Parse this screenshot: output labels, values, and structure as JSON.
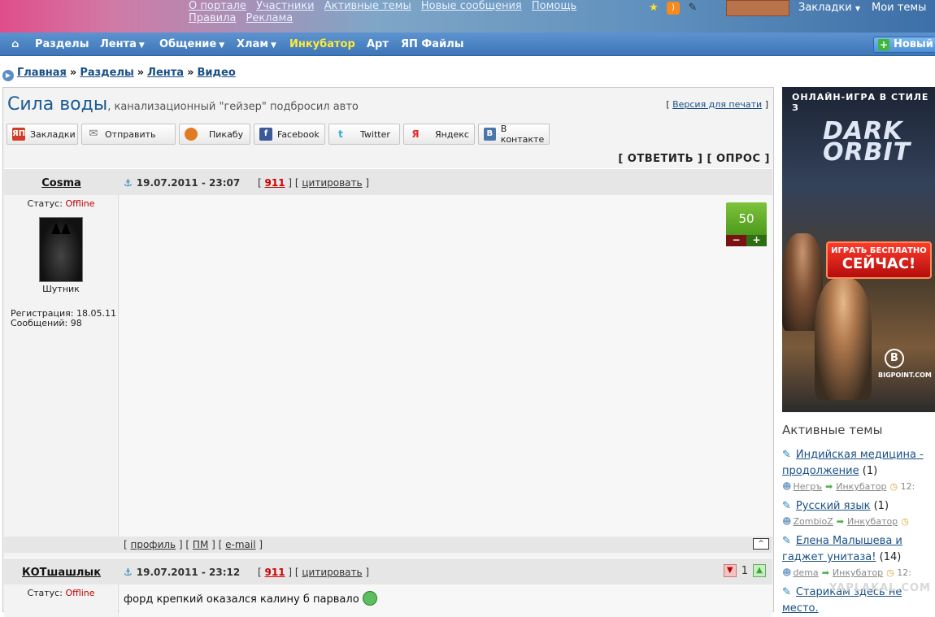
{
  "top": {
    "links": [
      "О портале",
      "Участники",
      "Активные темы",
      "Новые сообщения",
      "Помощь",
      "Правила",
      "Реклама"
    ],
    "bookmarks": "Закладки",
    "my_topics": "Мои темы"
  },
  "nav": {
    "items": [
      "Разделы",
      "Лента",
      "Общение",
      "Хлам",
      "Инкубатор",
      "Арт",
      "ЯП Файлы"
    ],
    "new_button": "Новый"
  },
  "breadcrumb": [
    "Главная",
    "Разделы",
    "Лента",
    "Видео"
  ],
  "topic": {
    "title": "Сила воды",
    "subtitle": ", канализационный \"гейзер\" подбросил авто",
    "print": "Версия для печати",
    "reply": "[ ОТВЕТИТЬ ] [ ОПРОС ]"
  },
  "share": [
    {
      "label": "Закладки",
      "icon": "yap-icon",
      "color": "#d23c26"
    },
    {
      "label": "Отправить",
      "icon": "mail-icon",
      "color": "#888888"
    },
    {
      "label": "Пикабу",
      "icon": "pikabu-icon",
      "color": "#e07b24"
    },
    {
      "label": "Facebook",
      "icon": "facebook-icon",
      "color": "#3b5998"
    },
    {
      "label": "Twitter",
      "icon": "twitter-icon",
      "color": "#33ccff"
    },
    {
      "label": "Яндекс",
      "icon": "yandex-icon",
      "color": "#e32b2b"
    },
    {
      "label": "В контакте",
      "icon": "vk-icon",
      "color": "#4a76a8"
    }
  ],
  "posts": [
    {
      "author": "Cosma",
      "date": "19.07.2011 - 23:07",
      "num": "911",
      "quote": "цитировать",
      "status_label": "Статус:",
      "status": "Offline",
      "rank": "Шутник",
      "reg": "Регистрация: 18.05.11",
      "msgs": "Сообщений: 98",
      "rating": "50",
      "footer": [
        "профиль",
        "ПМ",
        "e-mail"
      ]
    },
    {
      "author": "КОТшашлык",
      "date": "19.07.2011 - 23:12",
      "num": "911",
      "quote": "цитировать",
      "status_label": "Статус:",
      "status": "Offline",
      "votes": "1",
      "text": "форд крепкий оказался калину б парвало"
    }
  ],
  "ad": {
    "title": "ОНЛАЙН-ИГРА В СТИЛЕ З",
    "logo": "DARK ORBIT",
    "cta1": "ИГРАТЬ БЕСПЛАТНО",
    "cta2": "СЕЙЧАС!",
    "brand": "BIGPOINT.COM"
  },
  "sidebar": {
    "header": "Активные темы",
    "topics": [
      {
        "title": "Индийская медицина - продолжение",
        "count": "(1)",
        "user": "Негръ",
        "section": "Инкубатор",
        "time": "12:"
      },
      {
        "title": "Русский язык",
        "count": "(1)",
        "user": "ZombioZ",
        "section": "Инкубатор",
        "time": ""
      },
      {
        "title": "Елена Малышева и гаджет унитаза!",
        "count": "(14)",
        "user": "dema",
        "section": "Инкубатор",
        "time": "12:"
      },
      {
        "title": "Старикам здесь не место.",
        "count": "",
        "user": "",
        "section": "",
        "time": ""
      }
    ]
  },
  "watermark": "YAPLAKAL.COM"
}
